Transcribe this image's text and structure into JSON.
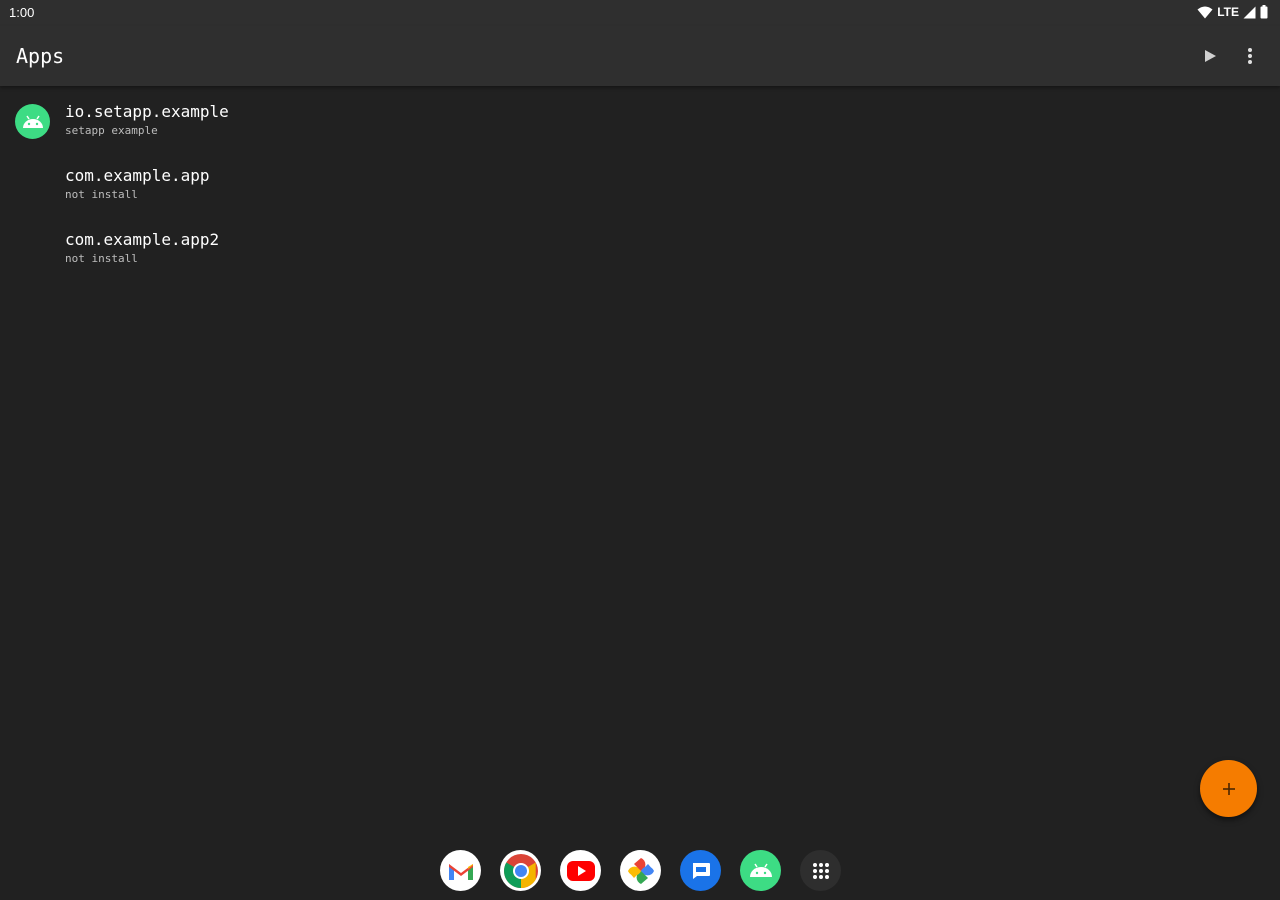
{
  "status_bar": {
    "time": "1:00",
    "network": "LTE",
    "icons": [
      "wifi-icon",
      "signal-icon",
      "battery-icon"
    ]
  },
  "app_bar": {
    "title": "Apps",
    "actions": [
      "play-icon",
      "more-vert-icon"
    ]
  },
  "apps": [
    {
      "package": "io.setapp.example",
      "subtitle": "setapp example",
      "icon": "android-icon"
    },
    {
      "package": "com.example.app",
      "subtitle": "not install"
    },
    {
      "package": "com.example.app2",
      "subtitle": "not install"
    }
  ],
  "fab": {
    "label": "+",
    "icon": "add-icon"
  },
  "dock": {
    "apps": [
      "gmail-icon",
      "chrome-icon",
      "youtube-icon",
      "photos-icon",
      "messages-icon",
      "android-icon",
      "app-drawer-icon"
    ]
  },
  "colors": {
    "background": "#212121",
    "bar": "#2f2f2f",
    "accent_fab": "#f57c00",
    "android_green": "#3ddc84"
  }
}
